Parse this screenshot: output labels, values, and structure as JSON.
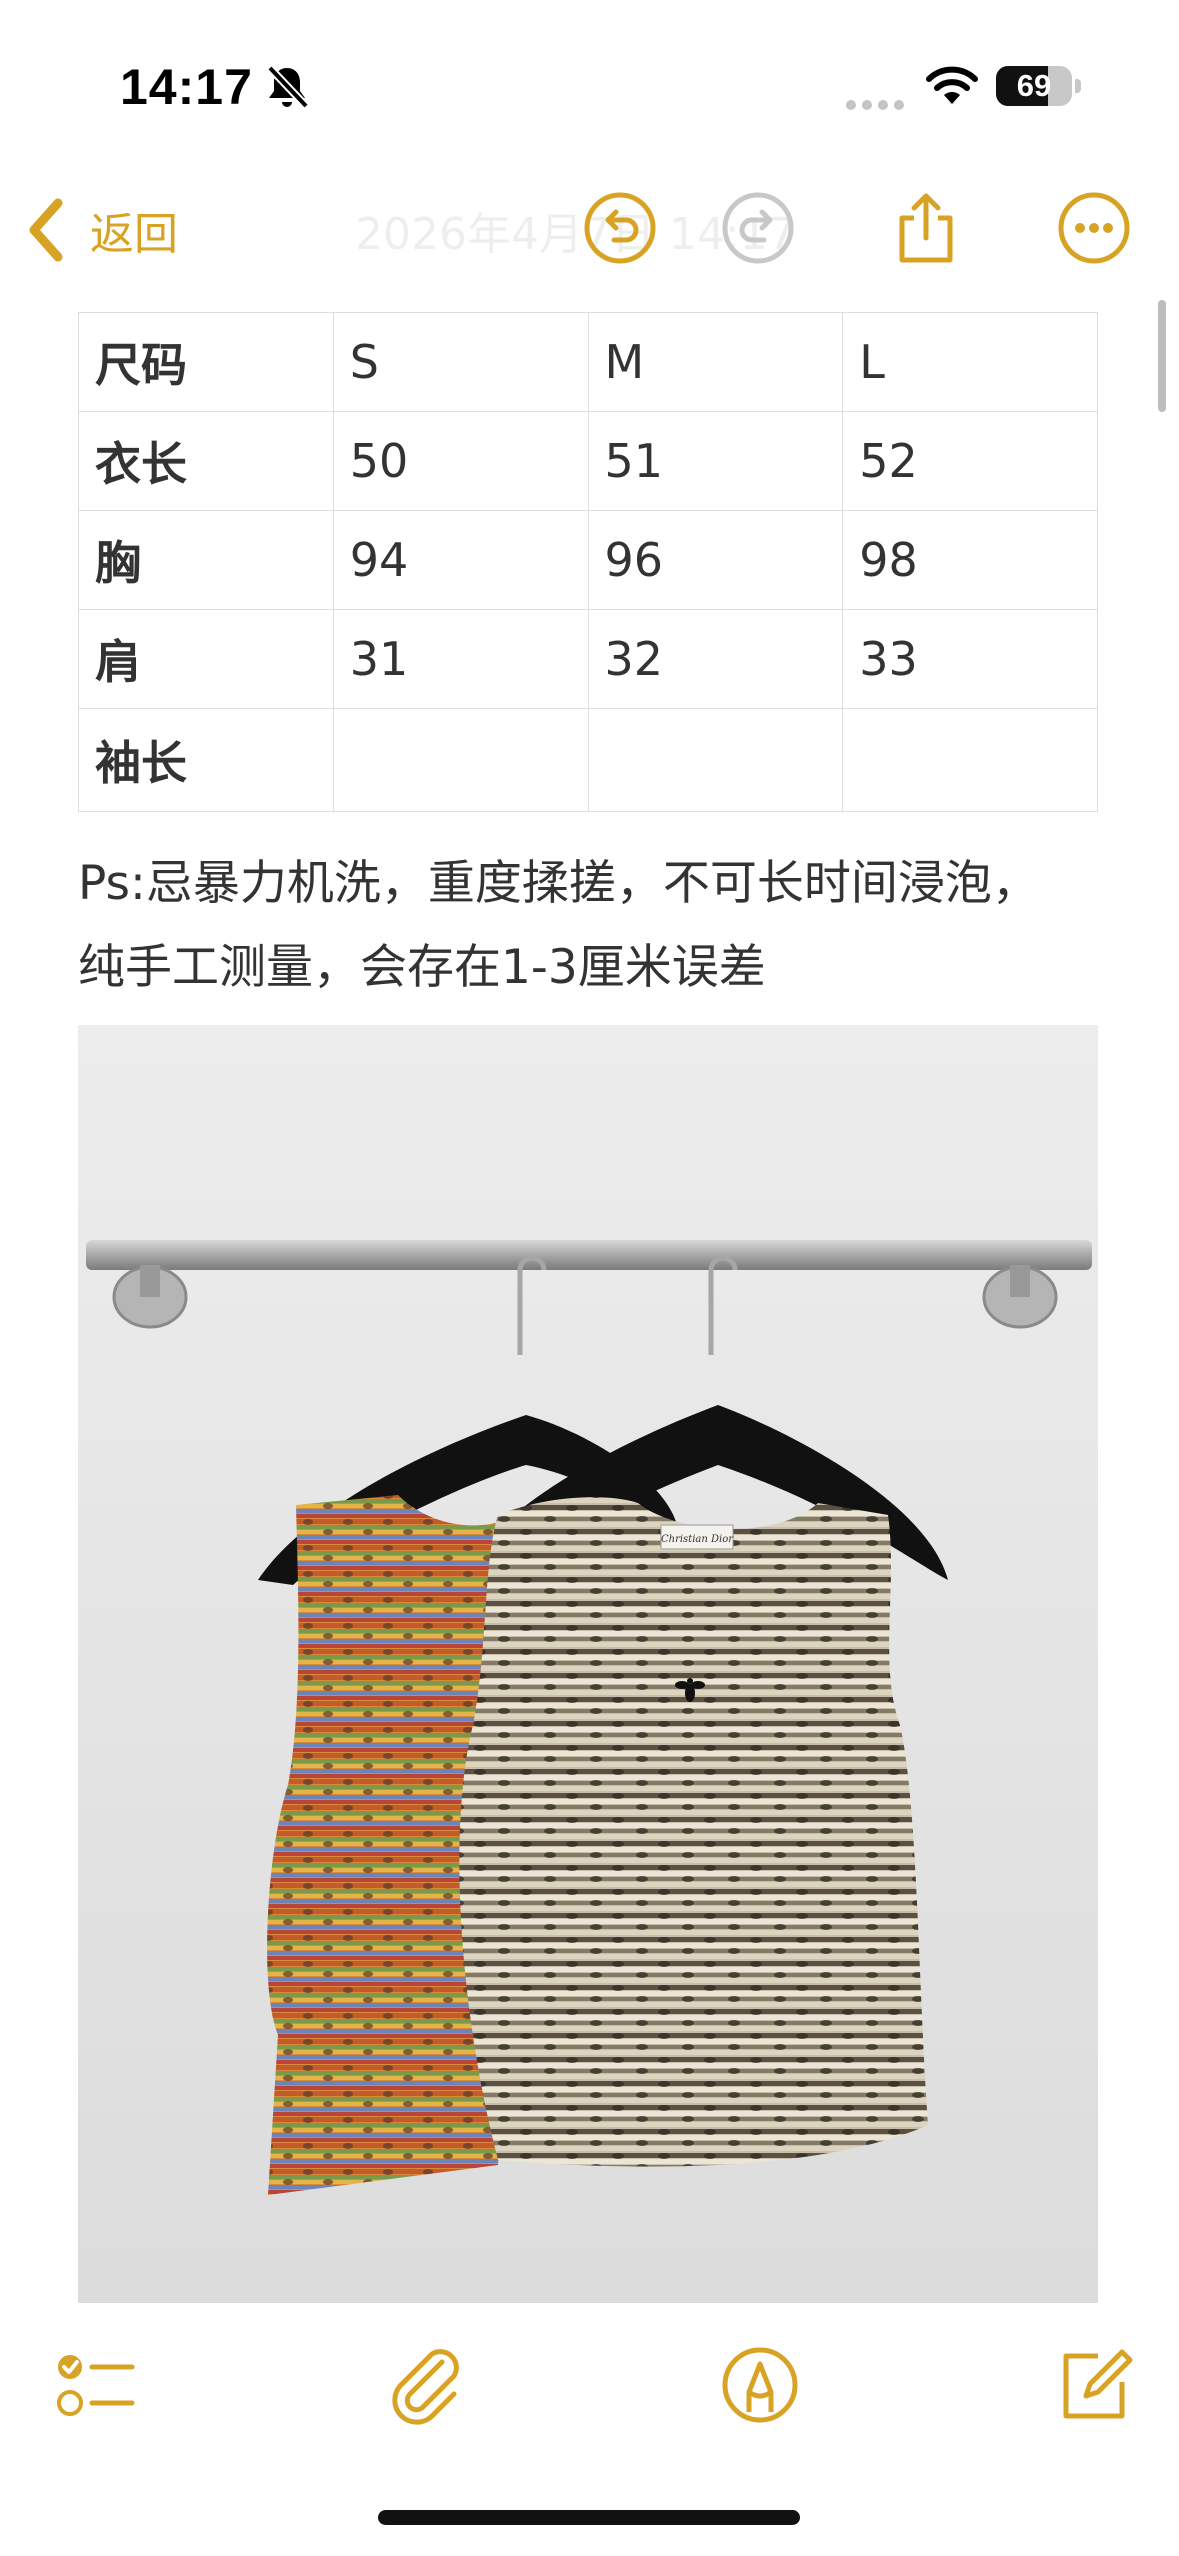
{
  "status_bar": {
    "time": "14:17",
    "battery_percent": 69,
    "battery_label": "69",
    "icons": [
      "bell-slash-icon",
      "signal-dots-icon",
      "wifi-icon",
      "battery-icon"
    ]
  },
  "nav": {
    "back_label": "返回",
    "faded_title": "2026年4月7日 14:17",
    "icons": [
      "chevron-left-icon",
      "undo-icon",
      "redo-icon",
      "share-icon",
      "more-icon"
    ]
  },
  "colors": {
    "accent": "#d8a324",
    "disabled": "#c8c8c8",
    "text": "#333333",
    "grid": "#dedede"
  },
  "size_table": {
    "rows": [
      [
        "尺码",
        "S",
        "M",
        "L"
      ],
      [
        "衣长",
        "50",
        "51",
        "52"
      ],
      [
        "胸",
        "94",
        "96",
        "98"
      ],
      [
        "肩",
        "31",
        "32",
        "33"
      ],
      [
        "袖长",
        "",
        "",
        ""
      ]
    ]
  },
  "note": {
    "line1": "Ps:忌暴力机洗，重度揉搓，不可长时间浸泡，",
    "line2": "纯手工测量，会存在1-3厘米误差"
  },
  "photo": {
    "label_text": "Christian Dior"
  },
  "toolbar": {
    "icons": [
      "checklist-icon",
      "paperclip-icon",
      "markup-pen-icon",
      "compose-icon"
    ]
  }
}
